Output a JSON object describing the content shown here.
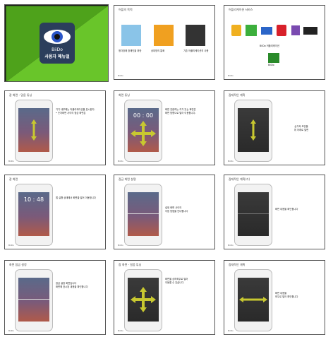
{
  "cover": {
    "app_name": "BiiDo",
    "subtitle": "사용자 메뉴얼"
  },
  "slide2": {
    "title": "어플의 목적",
    "captions": [
      "청각장애 장애인을 위한",
      "상대방의 통화",
      "기존 어플리케이션의 사용"
    ]
  },
  "slide3": {
    "title": "어플리케이션 서비스",
    "brand": "BiiDo",
    "desc": "BiiDo 어플리케이션"
  },
  "slide4": {
    "title": "잠 화면 - 밀움 튜닝",
    "time": "",
    "text": "기기 내부에는 어플리케이션을 표시한다.\n• 숫자화면 사이의 잠금 화면은"
  },
  "slide5": {
    "title": "화면 튜닝",
    "time": "00 : 00",
    "text": "화면 전환하는 키가 있는 화면은\n화면 방향으로 밀어 이동합니다."
  },
  "slide6": {
    "title": "잠재적인 계획",
    "text": "손가락 모양을\n위 아래로 밀면"
  },
  "slide7": {
    "title": "잠 화면",
    "time": "10 : 48",
    "text": "앱 실행 상태에서 화면을 밀어 이동합니다"
  },
  "slide8": {
    "title": "잠금 화면 설명",
    "text": "설정 화면 사이의\n이동 방법을 안내합니다"
  },
  "slide9": {
    "title": "잠재적인 계획(가)",
    "text": "화면 내용을 확인합니다"
  },
  "slide10": {
    "title": "화면 잠금 설정",
    "text": "잠금 설정 화면입니다\n화면에 표시된 내용을 확인합니다"
  },
  "slide11": {
    "title": "잠 화면 - 밀움 튜닝",
    "text": "화면을 상하좌우로 밀어\n이동할 수 있습니다"
  },
  "slide12": {
    "title": "잠재적인 계획",
    "text": "화면 내용을\n좌우로 밀어 확인합니다"
  },
  "footer_label": "BiiDo",
  "colors": {
    "accent_green": "#4caf20",
    "arrow_yellow": "#c8c830",
    "bg_dark": "#222222"
  }
}
